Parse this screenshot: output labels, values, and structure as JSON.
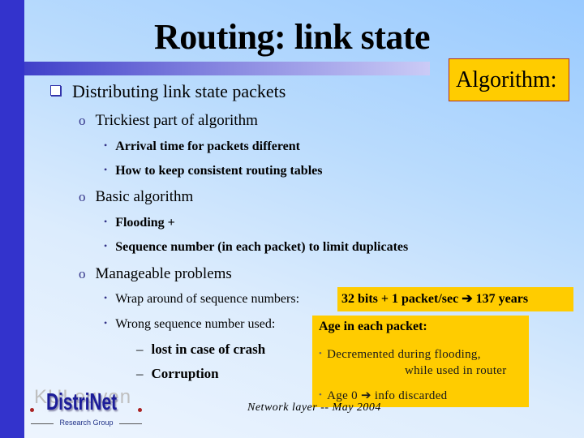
{
  "slide": {
    "title": "Routing:  link state",
    "callout": "Algorithm:",
    "colors": {
      "left_bar": "#3333cc",
      "highlight": "#ffcc00",
      "callout_border": "#b03020"
    },
    "main_bullet": "Distributing link state packets",
    "sections": [
      {
        "label": "Trickiest part of algorithm",
        "items": [
          "Arrival time for packets different",
          "How to keep consistent routing tables"
        ]
      },
      {
        "label": "Basic algorithm",
        "items": [
          "Flooding +",
          "Sequence number (in each packet) to limit  duplicates"
        ]
      },
      {
        "label": "Manageable problems",
        "items": [
          "Wrap around of sequence numbers:",
          "Wrong sequence number used:"
        ],
        "subitems": [
          "lost in case of crash",
          "Corruption"
        ]
      }
    ],
    "wrap_highlight": "32 bits + 1 packet/sec ➔ 137 years",
    "age_box": {
      "title": "Age in each packet:",
      "items": [
        "Decremented during flooding,",
        "while used in router",
        "Age 0 ➔  info discarded"
      ]
    },
    "footer": "Network layer -- May 2004",
    "logo": {
      "top_text": "KULeuven",
      "name": "DistriNet",
      "subtitle": "Research Group"
    },
    "bullets": {
      "level2": "o",
      "level3": "•",
      "level4": "–"
    }
  }
}
